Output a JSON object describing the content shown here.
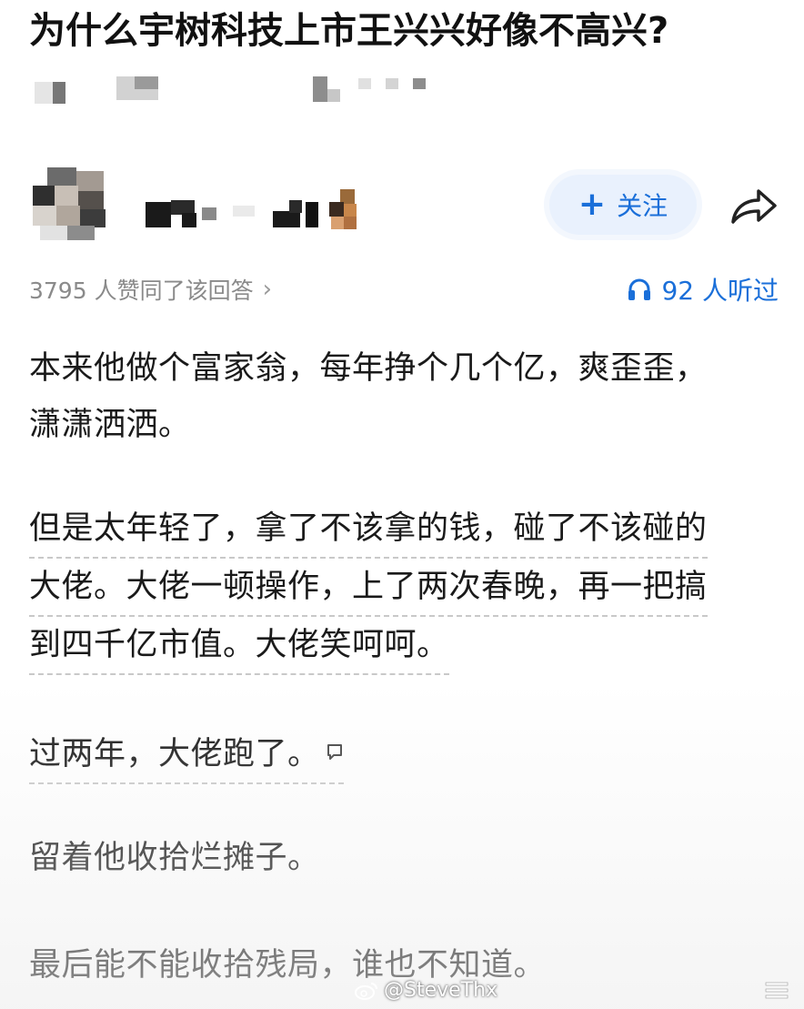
{
  "question": {
    "title": "为什么宇树科技上市王兴兴好像不高兴?"
  },
  "author": {
    "follow_label": "关注",
    "follow_icon": "plus-icon",
    "share_icon": "share-icon"
  },
  "stats": {
    "agree_text": "3795 人赞同了该回答",
    "listen_text": "92 人听过"
  },
  "answer": {
    "p1_lines": [
      "本来他做个富家翁，每年挣个几个亿，爽歪歪，",
      "潇潇洒洒。"
    ],
    "p2_lines": [
      "但是太年轻了，拿了不该拿的钱，碰了不该碰的",
      "大佬。大佬一顿操作，上了两次春晚，再一把搞",
      "到四千亿市值。大佬笑呵呵。"
    ],
    "p3": "过两年，大佬跑了。",
    "p4": "留着他收拾烂摊子。",
    "p5": "最后能不能收拾残局，谁也不知道。"
  },
  "watermark": {
    "text": "@SteveThx"
  },
  "colors": {
    "accent": "#1a6fd9",
    "follow_bg": "#e9f1fd",
    "muted": "#8a8a8a"
  }
}
